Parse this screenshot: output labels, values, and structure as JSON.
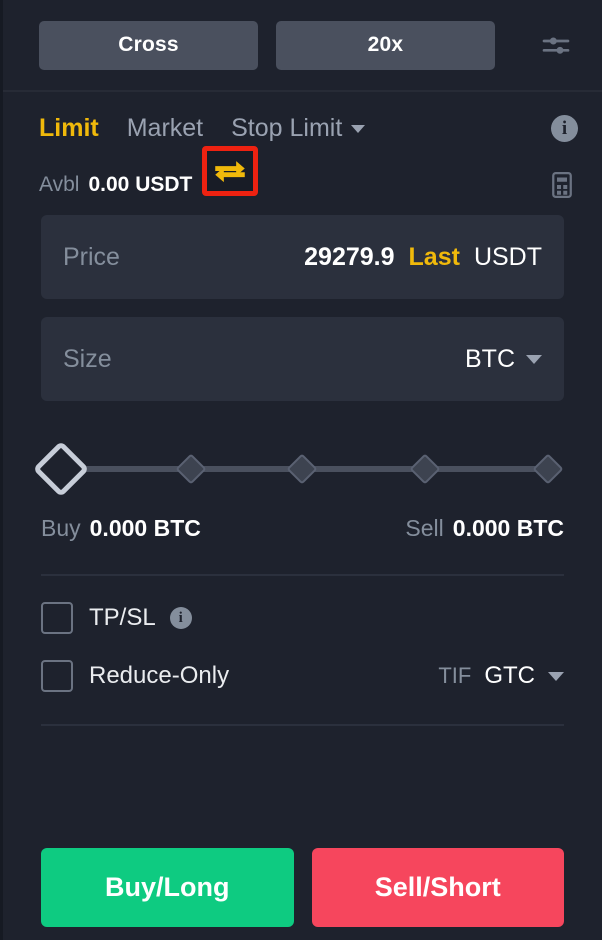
{
  "header": {
    "margin_mode": "Cross",
    "leverage": "20x",
    "settings_icon": "sliders-icon"
  },
  "order_types": {
    "tabs": [
      {
        "label": "Limit",
        "active": true
      },
      {
        "label": "Market",
        "active": false
      },
      {
        "label": "Stop Limit",
        "active": false,
        "has_dropdown": true
      }
    ],
    "info_icon": "info-icon",
    "info_glyph": "i"
  },
  "balance": {
    "label": "Avbl",
    "value": "0.00 USDT",
    "swap_icon": "swap-transfer-icon",
    "calculator_icon": "calculator-icon",
    "highlight_color": "#ee2211"
  },
  "price_field": {
    "placeholder": "Price",
    "value": "29279.9",
    "last_label": "Last",
    "unit": "USDT"
  },
  "size_field": {
    "placeholder": "Size",
    "unit": "BTC"
  },
  "slider": {
    "value": 0,
    "ticks": [
      0,
      25,
      50,
      75,
      100
    ]
  },
  "estimate": {
    "buy_label": "Buy",
    "buy_value": "0.000 BTC",
    "sell_label": "Sell",
    "sell_value": "0.000 BTC"
  },
  "options": {
    "tpsl_label": "TP/SL",
    "tpsl_checked": false,
    "tpsl_info_glyph": "i",
    "reduce_only_label": "Reduce-Only",
    "reduce_only_checked": false,
    "tif_label": "TIF",
    "tif_value": "GTC"
  },
  "actions": {
    "buy_label": "Buy/Long",
    "sell_label": "Sell/Short",
    "buy_color": "#0ecb81",
    "sell_color": "#f6465d"
  }
}
